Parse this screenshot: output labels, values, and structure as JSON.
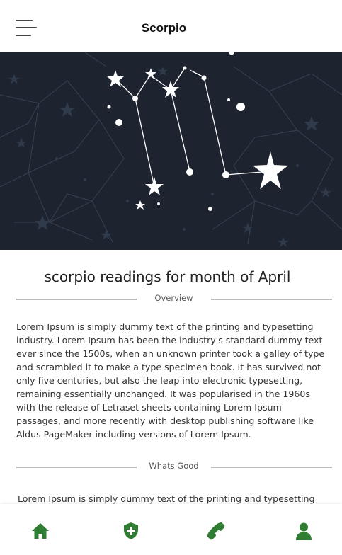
{
  "header": {
    "title": "Scorpio",
    "menu_icon": "hamburger-menu-icon"
  },
  "hero": {
    "image": "scorpio-constellation-illustration",
    "background_color": "#1d2430",
    "star_color": "#ffffff"
  },
  "content": {
    "heading": "scorpio readings for month of April",
    "sections": [
      {
        "label": "Overview",
        "text": "Lorem Ipsum is simply dummy text of the printing and typesetting industry. Lorem Ipsum has been the industry's standard dummy text ever since the 1500s, when an unknown printer took a galley of type and scrambled it to make a type specimen book. It has survived not only five centuries, but also the leap into electronic typesetting, remaining essentially unchanged. It was popularised in the 1960s with the release of Letraset sheets containing Lorem Ipsum passages, and more recently with desktop publishing software like Aldus PageMaker including versions of Lorem Ipsum."
      },
      {
        "label": "Whats Good",
        "text": "Lorem Ipsum is simply dummy text of the printing and typesetting"
      }
    ]
  },
  "bottom_nav": {
    "accent_color": "#2e7d32",
    "items": [
      {
        "icon": "home-icon"
      },
      {
        "icon": "health-shield-icon"
      },
      {
        "icon": "phone-icon"
      },
      {
        "icon": "user-icon"
      }
    ]
  }
}
